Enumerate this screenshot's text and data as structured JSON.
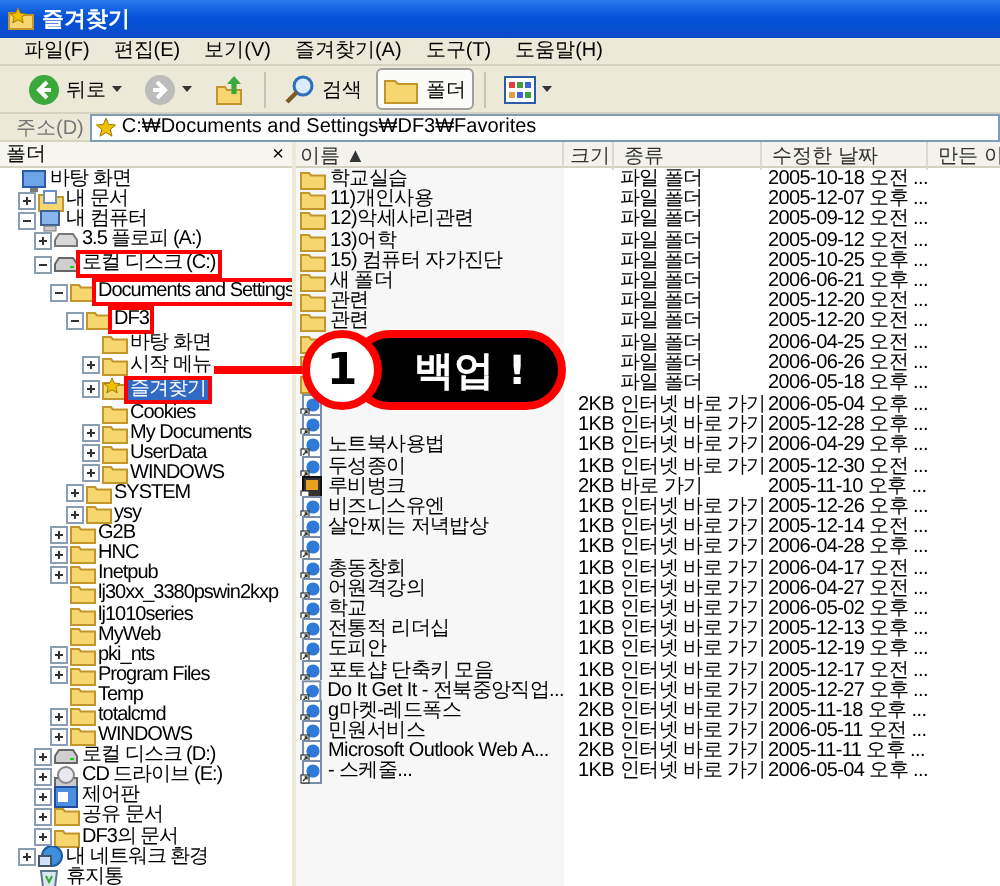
{
  "window": {
    "title": "즐겨찾기"
  },
  "menu": [
    "파일(F)",
    "편집(E)",
    "보기(V)",
    "즐겨찾기(A)",
    "도구(T)",
    "도움말(H)"
  ],
  "toolbar": [
    {
      "kind": "back",
      "label": "뒤로",
      "pressed": false
    },
    {
      "kind": "forward",
      "pressed": false
    },
    {
      "kind": "up",
      "pressed": false
    },
    {
      "kind": "search",
      "label": "검색",
      "pressed": false
    },
    {
      "kind": "folders",
      "label": "폴더",
      "pressed": true
    },
    {
      "kind": "views",
      "pressed": false
    }
  ],
  "address": {
    "label": "주소(D)",
    "value": "C:₩Documents and Settings₩DF3₩Favorites"
  },
  "folders_pane": {
    "title": "폴더",
    "close": "×"
  },
  "tree": [
    {
      "label": "바탕 화면",
      "kind": "desktop",
      "selected": false,
      "boxed": false,
      "children": [
        {
          "label": "내 문서",
          "kind": "documents",
          "expanded": false,
          "selected": false,
          "boxed": false
        },
        {
          "label": "내 컴퓨터",
          "kind": "computer",
          "expanded": true,
          "selected": false,
          "boxed": false,
          "children": [
            {
              "label": "3.5 플로피 (A:)",
              "kind": "floppy",
              "expanded": false,
              "selected": false,
              "boxed": false
            },
            {
              "label": "로컬 디스크 (C:)",
              "kind": "drive",
              "expanded": true,
              "selected": false,
              "boxed": true,
              "children": [
                {
                  "label": "Documents and Settings",
                  "kind": "folder",
                  "expanded": true,
                  "selected": false,
                  "boxed": true,
                  "children": [
                    {
                      "label": "DF3",
                      "kind": "folder",
                      "expanded": true,
                      "selected": false,
                      "boxed": true,
                      "children": [
                        {
                          "label": "바탕 화면",
                          "kind": "folder",
                          "selected": false,
                          "boxed": false
                        },
                        {
                          "label": "시작 메뉴",
                          "kind": "folder",
                          "expanded": false,
                          "selected": false,
                          "boxed": false
                        },
                        {
                          "label": "즐겨찾기",
                          "kind": "favorites",
                          "expanded": false,
                          "selected": true,
                          "boxed": true
                        },
                        {
                          "label": "Cookies",
                          "kind": "folder",
                          "selected": false,
                          "boxed": false
                        },
                        {
                          "label": "My Documents",
                          "kind": "folder",
                          "expanded": false,
                          "selected": false,
                          "boxed": false
                        },
                        {
                          "label": "UserData",
                          "kind": "folder",
                          "expanded": false,
                          "selected": false,
                          "boxed": false
                        },
                        {
                          "label": "WINDOWS",
                          "kind": "folder",
                          "expanded": false,
                          "selected": false,
                          "boxed": false
                        }
                      ]
                    },
                    {
                      "label": "SYSTEM",
                      "kind": "folder",
                      "expanded": false,
                      "selected": false,
                      "boxed": false
                    },
                    {
                      "label": "ysy",
                      "kind": "folder",
                      "expanded": false,
                      "selected": false,
                      "boxed": false
                    }
                  ]
                },
                {
                  "label": "G2B",
                  "kind": "folder",
                  "expanded": false,
                  "selected": false,
                  "boxed": false
                },
                {
                  "label": "HNC",
                  "kind": "folder",
                  "expanded": false,
                  "selected": false,
                  "boxed": false
                },
                {
                  "label": "Inetpub",
                  "kind": "folder",
                  "expanded": false,
                  "selected": false,
                  "boxed": false
                },
                {
                  "label": "lj30xx_3380pswin2kxp",
                  "kind": "folder",
                  "selected": false,
                  "boxed": false
                },
                {
                  "label": "lj1010series",
                  "kind": "folder",
                  "selected": false,
                  "boxed": false
                },
                {
                  "label": "MyWeb",
                  "kind": "folder",
                  "selected": false,
                  "boxed": false
                },
                {
                  "label": "pki_nts",
                  "kind": "folder",
                  "expanded": false,
                  "selected": false,
                  "boxed": false
                },
                {
                  "label": "Program Files",
                  "kind": "folder",
                  "expanded": false,
                  "selected": false,
                  "boxed": false
                },
                {
                  "label": "Temp",
                  "kind": "folder",
                  "selected": false,
                  "boxed": false
                },
                {
                  "label": "totalcmd",
                  "kind": "folder",
                  "expanded": false,
                  "selected": false,
                  "boxed": false
                },
                {
                  "label": "WINDOWS",
                  "kind": "folder",
                  "expanded": false,
                  "selected": false,
                  "boxed": false
                }
              ]
            },
            {
              "label": "로컬 디스크 (D:)",
              "kind": "drive",
              "expanded": false,
              "selected": false,
              "boxed": false
            },
            {
              "label": "CD 드라이브 (E:)",
              "kind": "cd",
              "expanded": false,
              "selected": false,
              "boxed": false
            },
            {
              "label": "제어판",
              "kind": "control",
              "expanded": false,
              "selected": false,
              "boxed": false
            },
            {
              "label": "공유 문서",
              "kind": "folder",
              "expanded": false,
              "selected": false,
              "boxed": false
            },
            {
              "label": "DF3의 문서",
              "kind": "folder",
              "expanded": false,
              "selected": false,
              "boxed": false
            }
          ]
        },
        {
          "label": "내 네트워크 환경",
          "kind": "network",
          "expanded": false,
          "selected": false,
          "boxed": false
        },
        {
          "label": "휴지통",
          "kind": "recycle",
          "selected": false,
          "boxed": false
        }
      ]
    }
  ],
  "table": {
    "columns": [
      "이름 ▲",
      "크기",
      "종류",
      "수정한 날짜",
      "만든 이"
    ],
    "rows": [
      {
        "kind": "folder",
        "name": "학교실습",
        "type": "파일 폴더",
        "modified": "2005-10-18 오전 ..."
      },
      {
        "kind": "folder",
        "name": "11)개인사용",
        "type": "파일 폴더",
        "modified": "2005-12-07 오후 ..."
      },
      {
        "kind": "folder",
        "name": "12)악세사리관련",
        "type": "파일 폴더",
        "modified": "2005-09-12 오전 ..."
      },
      {
        "kind": "folder",
        "name": "13)어학",
        "type": "파일 폴더",
        "modified": "2005-09-12 오전 ..."
      },
      {
        "kind": "folder",
        "name": "15) 컴퓨터 자가진단",
        "type": "파일 폴더",
        "modified": "2005-10-25 오후 ..."
      },
      {
        "kind": "folder",
        "name": "새 폴더",
        "type": "파일 폴더",
        "modified": "2006-06-21 오후 ..."
      },
      {
        "kind": "folder",
        "name": "관련",
        "type": "파일 폴더",
        "modified": "2005-12-20 오전 ..."
      },
      {
        "kind": "folder",
        "name": "관련",
        "type": "파일 폴더",
        "modified": "2005-12-20 오전 ..."
      },
      {
        "kind": "folder",
        "type": "파일 폴더",
        "modified": "2006-04-25 오전 ..."
      },
      {
        "kind": "folder",
        "type": "파일 폴더",
        "modified": "2006-06-26 오전 ..."
      },
      {
        "kind": "folder",
        "type": "파일 폴더",
        "modified": "2006-05-18 오후 ..."
      },
      {
        "kind": "internet-shortcut",
        "size": "2KB",
        "type": "인터넷 바로 가기",
        "modified": "2006-05-04 오후 ..."
      },
      {
        "kind": "internet-shortcut",
        "size": "1KB",
        "type": "인터넷 바로 가기",
        "modified": "2005-12-28 오후 ..."
      },
      {
        "kind": "internet-shortcut",
        "name": "노트북사용법",
        "size": "1KB",
        "type": "인터넷 바로 가기",
        "modified": "2006-04-29 오후 ..."
      },
      {
        "kind": "internet-shortcut",
        "name": "두성종이",
        "size": "1KB",
        "type": "인터넷 바로 가기",
        "modified": "2005-12-30 오전 ..."
      },
      {
        "kind": "shortcut",
        "name": "루비벙크",
        "size": "2KB",
        "type": "바로 가기",
        "modified": "2005-11-10 오후 ..."
      },
      {
        "kind": "internet-shortcut",
        "name": "비즈니스유엔",
        "size": "1KB",
        "type": "인터넷 바로 가기",
        "modified": "2005-12-26 오후 ..."
      },
      {
        "kind": "internet-shortcut",
        "name": "살안찌는 저녁밥상",
        "size": "1KB",
        "type": "인터넷 바로 가기",
        "modified": "2005-12-14 오전 ..."
      },
      {
        "kind": "internet-shortcut",
        "size": "1KB",
        "type": "인터넷 바로 가기",
        "modified": "2006-04-28 오후 ..."
      },
      {
        "kind": "internet-shortcut",
        "name": "총동창회",
        "size": "1KB",
        "type": "인터넷 바로 가기",
        "modified": "2006-04-17 오전 ..."
      },
      {
        "kind": "internet-shortcut",
        "name": "어원격강의",
        "size": "1KB",
        "type": "인터넷 바로 가기",
        "modified": "2006-04-27 오전 ..."
      },
      {
        "kind": "internet-shortcut",
        "name": "학교",
        "size": "1KB",
        "type": "인터넷 바로 가기",
        "modified": "2006-05-02 오후 ..."
      },
      {
        "kind": "internet-shortcut",
        "name": "전통적 리더십",
        "size": "1KB",
        "type": "인터넷 바로 가기",
        "modified": "2005-12-13 오후 ..."
      },
      {
        "kind": "internet-shortcut",
        "name": "도피안",
        "size": "1KB",
        "type": "인터넷 바로 가기",
        "modified": "2005-12-19 오후 ..."
      },
      {
        "kind": "internet-shortcut",
        "name": "포토샵 단축키 모음",
        "size": "1KB",
        "type": "인터넷 바로 가기",
        "modified": "2005-12-17 오전 ..."
      },
      {
        "kind": "internet-shortcut",
        "name": "Do It Get It - 전북중앙직업...",
        "size": "1KB",
        "type": "인터넷 바로 가기",
        "modified": "2005-12-27 오후 ..."
      },
      {
        "kind": "internet-shortcut",
        "name": "g마켓-레드폭스",
        "size": "2KB",
        "type": "인터넷 바로 가기",
        "modified": "2005-11-18 오후 ..."
      },
      {
        "kind": "internet-shortcut",
        "name": "민원서비스",
        "size": "1KB",
        "type": "인터넷 바로 가기",
        "modified": "2006-05-11 오전 ..."
      },
      {
        "kind": "internet-shortcut",
        "name": "Microsoft Outlook Web A...",
        "size": "2KB",
        "type": "인터넷 바로 가기",
        "modified": "2005-11-11 오후 ..."
      },
      {
        "kind": "internet-shortcut",
        "name": "- 스케줄...",
        "size": "1KB",
        "type": "인터넷 바로 가기",
        "modified": "2006-05-04 오후 ..."
      }
    ]
  },
  "callout": {
    "number": "1",
    "text": "백업 !"
  }
}
